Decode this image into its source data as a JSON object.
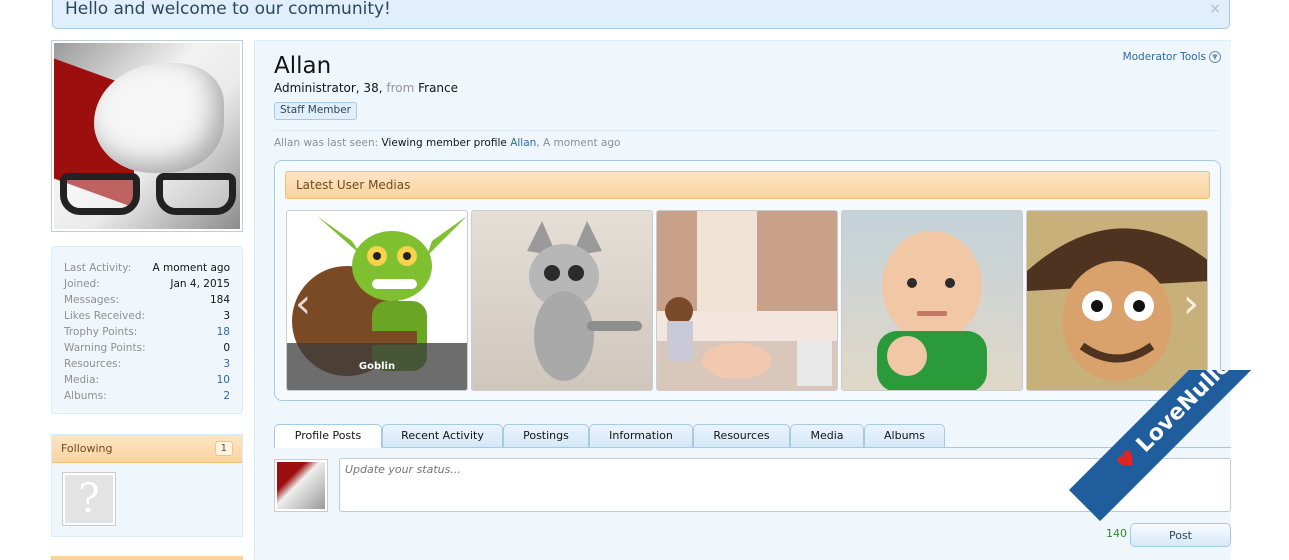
{
  "notice": {
    "text": "Hello and welcome to our community!",
    "close": "×"
  },
  "profile": {
    "name": "Allan",
    "role": "Administrator, 38,",
    "from_label": "from",
    "location": "France",
    "badge": "Staff Member",
    "moderator_tools": "Moderator Tools",
    "last_seen_prefix": "Allan was last seen:",
    "last_seen_action": "Viewing member profile",
    "last_seen_link": "Allan",
    "last_seen_time": ", A moment ago"
  },
  "stats": [
    {
      "label": "Last Activity:",
      "value": "A moment ago",
      "link": false
    },
    {
      "label": "Joined:",
      "value": "Jan 4, 2015",
      "link": false
    },
    {
      "label": "Messages:",
      "value": "184",
      "link": false
    },
    {
      "label": "Likes Received:",
      "value": "3",
      "link": false
    },
    {
      "label": "Trophy Points:",
      "value": "18",
      "link": true
    },
    {
      "label": "Warning Points:",
      "value": "0",
      "link": false
    },
    {
      "label": "Resources:",
      "value": "3",
      "link": true
    },
    {
      "label": "Media:",
      "value": "10",
      "link": true
    },
    {
      "label": "Albums:",
      "value": "2",
      "link": true
    }
  ],
  "following": {
    "title": "Following",
    "count": "1",
    "placeholder_glyph": "?"
  },
  "media": {
    "title": "Latest User Medias",
    "items": [
      {
        "caption": "Goblin"
      },
      {
        "caption": ""
      },
      {
        "caption": ""
      },
      {
        "caption": ""
      },
      {
        "caption": ""
      }
    ],
    "prev_glyph": "‹",
    "next_glyph": "›"
  },
  "tabs": [
    {
      "label": "Profile Posts",
      "active": true
    },
    {
      "label": "Recent Activity",
      "active": false
    },
    {
      "label": "Postings",
      "active": false
    },
    {
      "label": "Information",
      "active": false
    },
    {
      "label": "Resources",
      "active": false
    },
    {
      "label": "Media",
      "active": false
    },
    {
      "label": "Albums",
      "active": false
    }
  ],
  "status": {
    "placeholder": "Update your status...",
    "char_count": "140",
    "post_label": "Post"
  },
  "watermark": {
    "text": "LoveNulled.com"
  },
  "colors": {
    "accent": "#2b6aa8",
    "header_orange": "#fad3a0",
    "panel_blue": "#f0f7fc",
    "border_blue": "#a5cae4"
  }
}
